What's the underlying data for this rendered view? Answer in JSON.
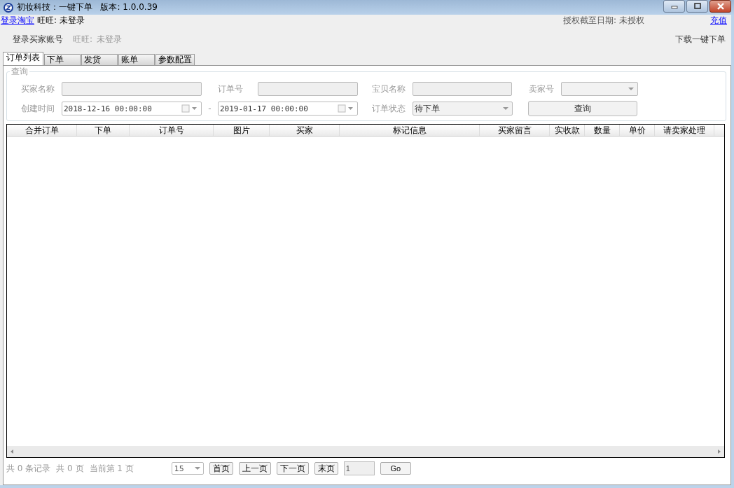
{
  "window": {
    "title": "初妆科技：一键下单   版本: 1.0.0.39"
  },
  "header": {
    "login_link": "登录淘宝",
    "wangwang_label": "旺旺:",
    "wangwang_value": "未登录",
    "license_label": "授权截至日期:",
    "license_value": "未授权",
    "recharge_link": "充值",
    "buyer_login": "登录买家账号",
    "buyer_wangwang_label": "旺旺:",
    "buyer_wangwang_value": "未登录",
    "download_link": "下载一键下单"
  },
  "tabs": [
    {
      "label": "订单列表",
      "selected": true
    },
    {
      "label": "下单",
      "selected": false
    },
    {
      "label": "发货",
      "selected": false
    },
    {
      "label": "账单",
      "selected": false
    },
    {
      "label": "参数配置",
      "selected": false
    }
  ],
  "query": {
    "title": "查询",
    "filters": [
      {
        "kind": "text",
        "label": "买家名称"
      },
      {
        "kind": "text",
        "label": "订单号"
      },
      {
        "kind": "text",
        "label": "宝贝名称"
      },
      {
        "kind": "combo",
        "label": "卖家号"
      },
      {
        "kind": "date_range",
        "label": "创建时间",
        "from": "2018-12-16 00:00:00",
        "separator": "-",
        "to": "2019-01-17 00:00:00"
      },
      {
        "kind": "combo",
        "label": "订单状态",
        "value": "待下单"
      }
    ],
    "search_button": "查询"
  },
  "table": {
    "columns": [
      "合并订单",
      "下单",
      "订单号",
      "图片",
      "买家",
      "标记信息",
      "买家留言",
      "实收款",
      "数量",
      "单价",
      "请卖家处理"
    ]
  },
  "footer": {
    "records": "共 0 条记录",
    "pages": "共 0 页",
    "current": "当前第 1 页",
    "page_size": "15",
    "buttons": [
      "首页",
      "上一页",
      "下一页",
      "末页"
    ],
    "page_input": "1",
    "go": "Go"
  }
}
